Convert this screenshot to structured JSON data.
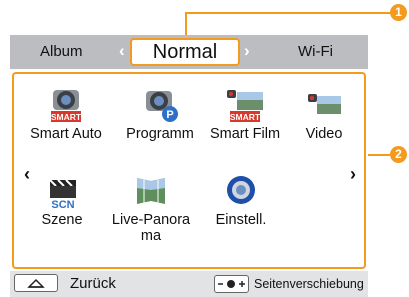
{
  "tabs": {
    "left": "Album",
    "center": "Normal",
    "right": "Wi-Fi"
  },
  "callouts": [
    "1",
    "2"
  ],
  "modes": [
    {
      "label": "Smart Auto",
      "badge": "SMART",
      "icon": "smart-auto-icon"
    },
    {
      "label": "Programm",
      "badge": "P",
      "icon": "program-icon"
    },
    {
      "label": "Smart Film",
      "badge": "SMART",
      "icon": "smart-film-icon"
    },
    {
      "label": "Video",
      "icon": "video-icon"
    },
    {
      "label": "Szene",
      "badge": "SCN",
      "icon": "scene-icon"
    },
    {
      "label": "Live-Panorama",
      "icon": "live-panorama-icon"
    },
    {
      "label": "Einstell.",
      "icon": "settings-icon"
    }
  ],
  "nav": {
    "prev": "‹",
    "next": "›"
  },
  "bottom": {
    "back_label": "Zurück",
    "page_label": "Seitenverschiebung"
  },
  "colors": {
    "accent": "#f39a1f",
    "tab_bar": "#bcbdc0",
    "bottom_bar": "#e2e3e4",
    "badge_red": "#d9382d",
    "badge_blue": "#2f6fc7"
  }
}
